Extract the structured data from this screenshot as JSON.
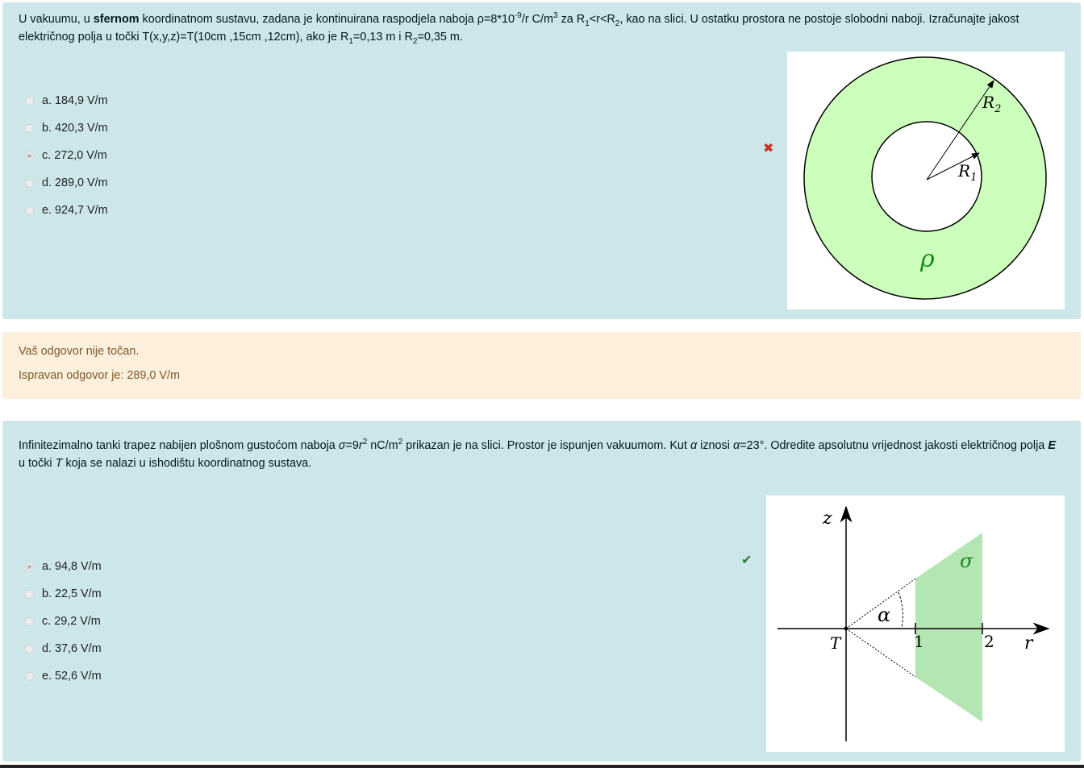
{
  "q1": {
    "text_pre": "U vakuumu, u ",
    "text_bold": "sfernom",
    "text_post": " koordinatnom sustavu, zadana je kontinuirana raspodjela naboja ρ=8*10",
    "sup_exp": "-9",
    "text_after_exp": "/r C/m",
    "sup_3": "3",
    "text_range": " za R",
    "sub_1": "1",
    "text_mid": "<r<R",
    "sub_2": "2",
    "text_end": ", kao na slici. U ostatku prostora ne postoje slobodni naboji. Izračunajte jakost električnog polja u točki T(x,y,z)=T(10cm ,15cm ,12cm), ako je R",
    "sub_1b": "1",
    "text_r1": "=0,13 m i R",
    "sub_2b": "2",
    "text_r2": "=0,35 m.",
    "options": [
      "a. 184,9 V/m",
      "b. 420,3 V/m",
      "c. 272,0 V/m",
      "d. 289,0 V/m",
      "e. 924,7 V/m"
    ],
    "selected_index": 2,
    "mark_glyph": "✖",
    "figure": {
      "label_r2": "R",
      "sub_r2": "2",
      "label_r1": "R",
      "sub_r1": "1",
      "label_rho": "ρ",
      "ring_color": "#ccffbb"
    }
  },
  "feedback": {
    "line1": "Vaš odgovor nije točan.",
    "line2": "Ispravan odgovor je: 289,0 V/m"
  },
  "q2": {
    "text_a": "Infinitezimalno tanki trapez nabijen plošnom gustoćom naboja ",
    "sigma_sym": "σ",
    "text_b": "=9",
    "r_sym": "r",
    "sup_2": "2",
    "text_c": " nC/m",
    "sup_2b": "2",
    "text_d": " prikazan je na slici. Prostor je ispunjen vakuumom. Kut ",
    "alpha_sym": "α",
    "text_e": " iznosi ",
    "alpha_sym2": "α",
    "text_f": "=23°. Odredite apsolutnu vrijednost jakosti električnog polja ",
    "e_sym": "E",
    "text_g": " u točki ",
    "t_sym": "T",
    "text_h": " koja se nalazi u ishodištu koordinatnog sustava.",
    "options": [
      "a. 94,8 V/m",
      "b. 22,5 V/m",
      "c. 29,2 V/m",
      "d. 37,6 V/m",
      "e. 52,6 V/m"
    ],
    "selected_index": 0,
    "mark_glyph": "✔",
    "figure": {
      "label_z": "z",
      "label_r": "r",
      "label_t": "T",
      "label_1": "1",
      "label_2": "2",
      "label_alpha": "α",
      "label_sigma": "σ",
      "fill_color": "#b3e6b3"
    }
  }
}
